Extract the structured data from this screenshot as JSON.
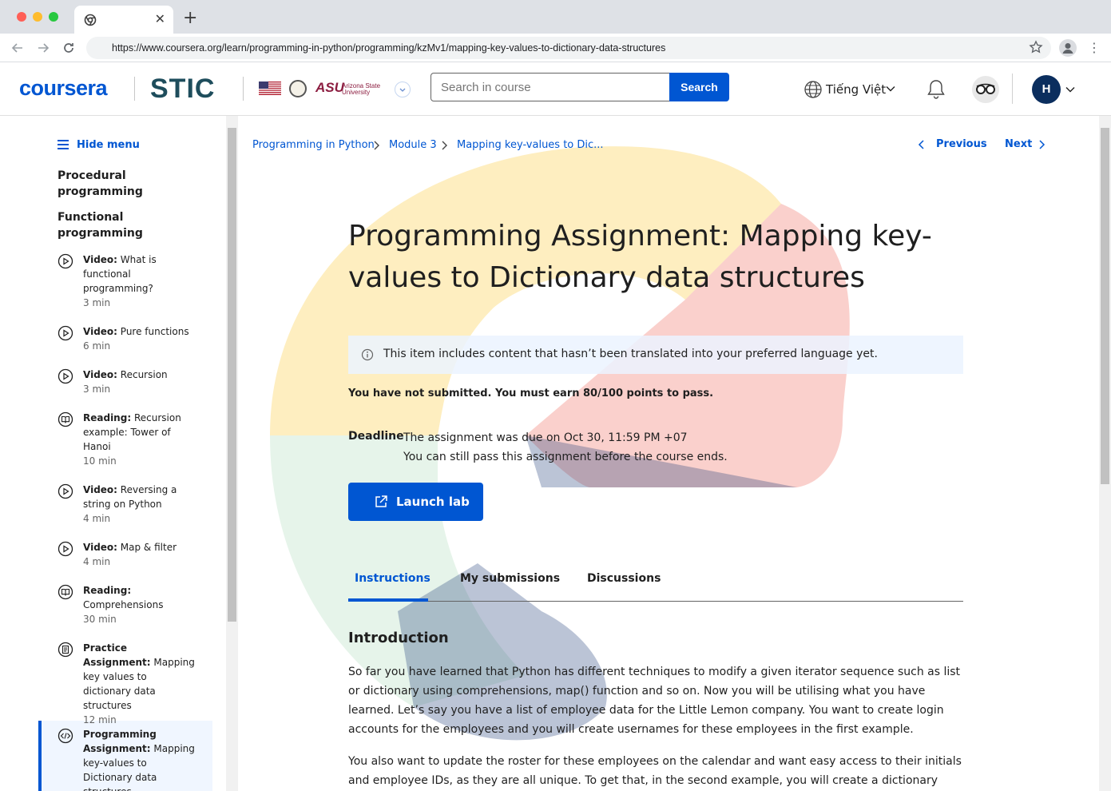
{
  "browser": {
    "tab_title": "",
    "url": "https://www.coursera.org/learn/programming-in-python/programming/kzMv1/mapping-key-values-to-dictionary-data-structures"
  },
  "header": {
    "logo": "coursera",
    "partner_logo": "STIC",
    "asu_logo": "ASU",
    "asu_sub": "Arizona State University",
    "search_placeholder": "Search in course",
    "search_button": "Search",
    "language": "Tiếng Việt",
    "user_initial": "H"
  },
  "sidebar": {
    "hide_menu": "Hide menu",
    "sections": [
      "Procedural programming",
      "Functional programming"
    ],
    "items": [
      {
        "type": "Video:",
        "title": "What is functional programming?",
        "duration": "3 min",
        "icon": "play-icon"
      },
      {
        "type": "Video:",
        "title": "Pure functions",
        "duration": "6 min",
        "icon": "play-icon"
      },
      {
        "type": "Video:",
        "title": "Recursion",
        "duration": "3 min",
        "icon": "play-icon"
      },
      {
        "type": "Reading:",
        "title": "Recursion example: Tower of Hanoi",
        "duration": "10 min",
        "icon": "book-icon"
      },
      {
        "type": "Video:",
        "title": "Reversing a string on Python",
        "duration": "4 min",
        "icon": "play-icon"
      },
      {
        "type": "Video:",
        "title": "Map & filter",
        "duration": "4 min",
        "icon": "play-icon"
      },
      {
        "type": "Reading:",
        "title": "Comprehensions",
        "duration": "30 min",
        "icon": "book-icon"
      },
      {
        "type": "Practice Assignment:",
        "title": "Mapping key values to dictionary data structures",
        "duration": "12 min",
        "icon": "assignment-icon"
      },
      {
        "type": "Programming Assignment:",
        "title": "Mapping key-values to Dictionary data structures",
        "duration": "",
        "icon": "code-icon"
      }
    ]
  },
  "main": {
    "breadcrumbs": [
      "Programming in Python",
      "Module 3",
      "Mapping key-values to Dic..."
    ],
    "previous": "Previous",
    "next": "Next",
    "title": "Programming Assignment: Mapping key-values to Dictionary data structures",
    "notice": "This item includes content that hasn’t been translated into your preferred language yet.",
    "status": "You have not submitted. You must earn 80/100 points to pass.",
    "deadline_label": "Deadline",
    "deadline_line1": "The assignment was due on Oct 30, 11:59 PM +07",
    "deadline_line2": "You can still pass this assignment before the course ends.",
    "launch_button": "Launch lab",
    "tabs": [
      "Instructions",
      "My submissions",
      "Discussions"
    ],
    "intro_heading": "Introduction",
    "paragraphs": [
      "So far you have learned that Python has different techniques to modify a given iterator sequence such as list or dictionary using comprehensions, map() function and so on. Now you will be utilising what you have learned. Let’s say you have a list of employee data for the Little Lemon company. You want to create login accounts for the employees and you will create usernames for these employees in the first example.",
      "You also want to update the roster for these employees on the calendar and want easy access to their initials and employee IDs, as they are all unique. To get that, in the second example, you will create a dictionary with the"
    ]
  },
  "colors": {
    "accent": "#0056d2",
    "stic": "#1e4d5c",
    "asu": "#8c1d40"
  }
}
